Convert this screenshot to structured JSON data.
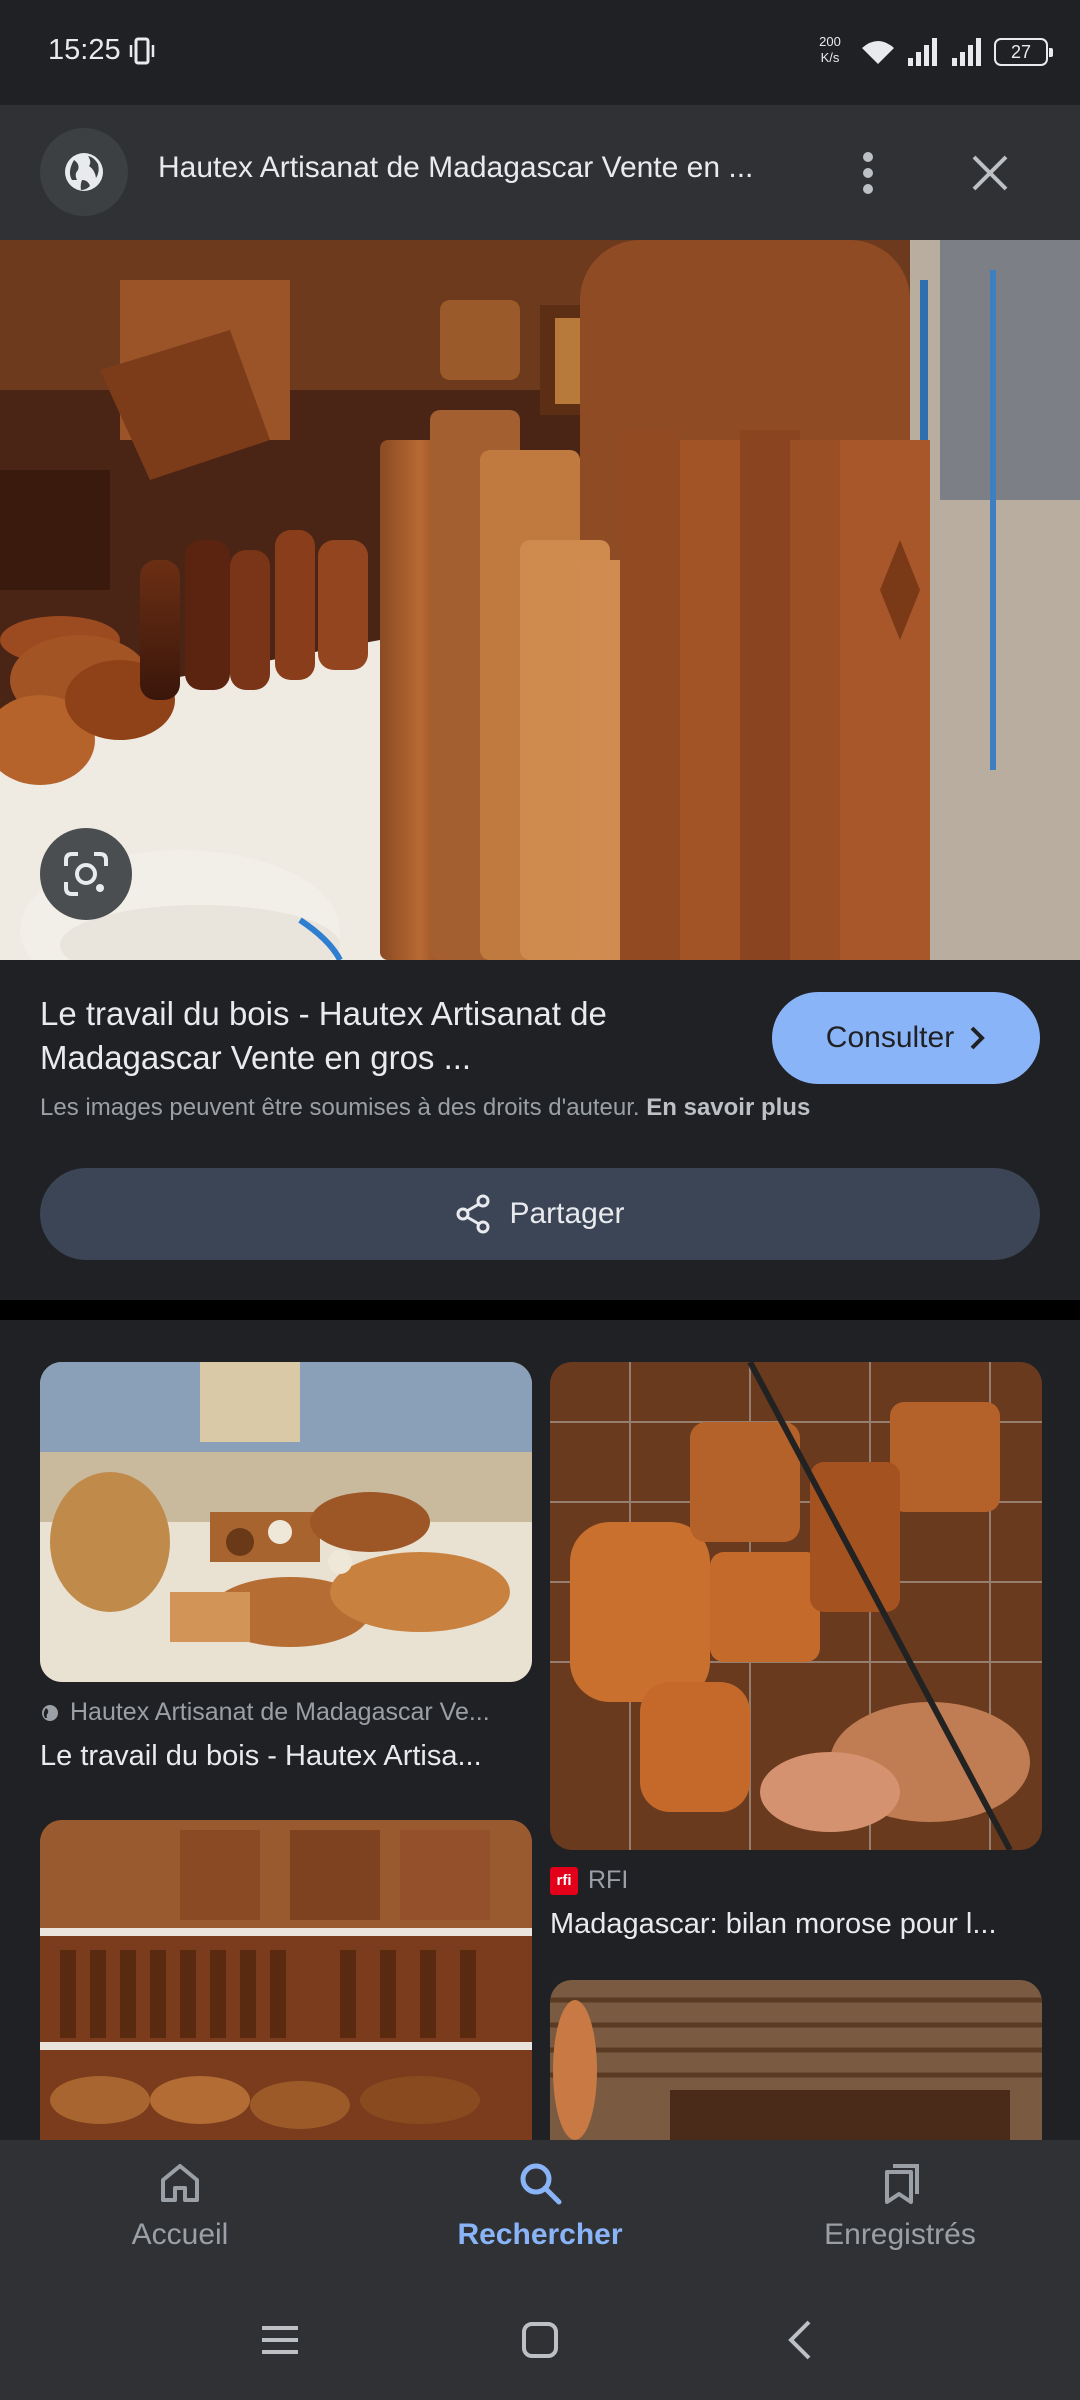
{
  "status_bar": {
    "time": "15:25",
    "net_speed_value": "200",
    "net_speed_unit": "K/s",
    "battery": "27"
  },
  "header": {
    "title": "Hautex Artisanat de Madagascar Vente en ...",
    "globe_icon": "globe-icon",
    "more_icon": "more-vert-icon",
    "close_icon": "close-icon"
  },
  "hero": {
    "lens_icon": "google-lens-icon"
  },
  "info": {
    "title": "Le travail du bois - Hautex Artisanat de Madagascar Vente en gros ...",
    "visit_label": "Consulter",
    "copyright_text": "Les images peuvent être soumises à des droits d'auteur.",
    "learn_more": "En savoir plus",
    "share_label": "Partager"
  },
  "related": [
    {
      "source": "Hautex Artisanat de Madagascar Ve...",
      "title": "Le travail du bois - Hautex Artisa..."
    },
    {
      "source": "RFI",
      "title": "Madagascar: bilan morose pour l..."
    }
  ],
  "bottom_nav": [
    {
      "label": "Accueil",
      "icon": "home-icon",
      "active": false
    },
    {
      "label": "Rechercher",
      "icon": "search-icon",
      "active": true
    },
    {
      "label": "Enregistrés",
      "icon": "bookmarks-icon",
      "active": false
    }
  ],
  "colors": {
    "background": "#202124",
    "accent": "#8ab4f8",
    "surface": "#303134"
  }
}
